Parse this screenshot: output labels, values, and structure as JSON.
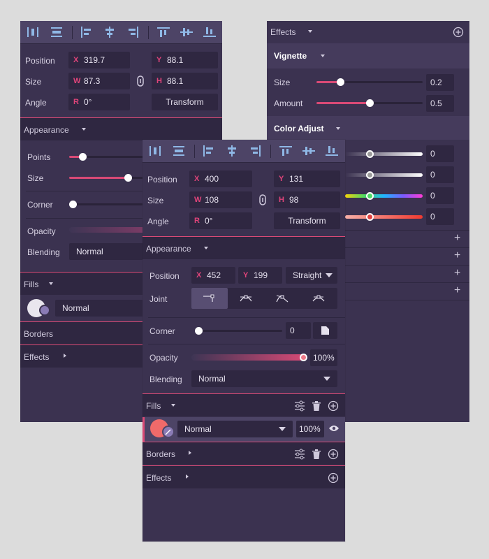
{
  "left_panel": {
    "transform": {
      "position_label": "Position",
      "size_label": "Size",
      "angle_label": "Angle",
      "x_prefix": "X",
      "x": "319.7",
      "y_prefix": "Y",
      "y": "88.1",
      "w_prefix": "W",
      "w": "87.3",
      "h_prefix": "H",
      "h": "88.1",
      "r_prefix": "R",
      "r": "0°",
      "transform_button": "Transform"
    },
    "appearance": {
      "title": "Appearance",
      "points_label": "Points",
      "points_value": 0.17,
      "size_label": "Size",
      "size_value": 0.81,
      "corner_label": "Corner",
      "corner_value": 0.0,
      "opacity_label": "Opacity",
      "blending_label": "Blending",
      "blending_value": "Normal"
    },
    "fills": {
      "title": "Fills",
      "blend": "Normal"
    },
    "borders": {
      "title": "Borders"
    },
    "effects": {
      "title": "Effects"
    }
  },
  "right_panel": {
    "effects_title": "Effects",
    "vignette": {
      "title": "Vignette",
      "size_label": "Size",
      "size_value": "0.2",
      "size_fraction": 0.2,
      "amount_label": "Amount",
      "amount_value": "0.5",
      "amount_fraction": 0.5
    },
    "color_adjust": {
      "title": "Color Adjust",
      "rows": [
        "0",
        "0",
        "0",
        "0"
      ]
    }
  },
  "front_panel": {
    "transform": {
      "position_label": "Position",
      "size_label": "Size",
      "angle_label": "Angle",
      "x_prefix": "X",
      "x": "400",
      "y_prefix": "Y",
      "y": "131",
      "w_prefix": "W",
      "w": "108",
      "h_prefix": "H",
      "h": "98",
      "r_prefix": "R",
      "r": "0°",
      "transform_button": "Transform"
    },
    "appearance": {
      "title": "Appearance",
      "position_label": "Position",
      "x_prefix": "X",
      "x": "452",
      "y_prefix": "Y",
      "y": "199",
      "line_type": "Straight",
      "joint_label": "Joint",
      "corner_label": "Corner",
      "corner_value": "0",
      "corner_fraction": 0.0,
      "opacity_label": "Opacity",
      "opacity_value": "100%",
      "opacity_fraction": 1.0,
      "blending_label": "Blending",
      "blending_value": "Normal"
    },
    "fills": {
      "title": "Fills",
      "blend": "Normal",
      "opacity": "100%",
      "swatch_color": "#f06a6a"
    },
    "borders": {
      "title": "Borders"
    },
    "effects": {
      "title": "Effects"
    }
  },
  "colors": {
    "panel_bg": "#3b3250",
    "section_bg": "#2f2741",
    "accent": "#d94a76",
    "toolbar_bg": "#4d4466"
  }
}
